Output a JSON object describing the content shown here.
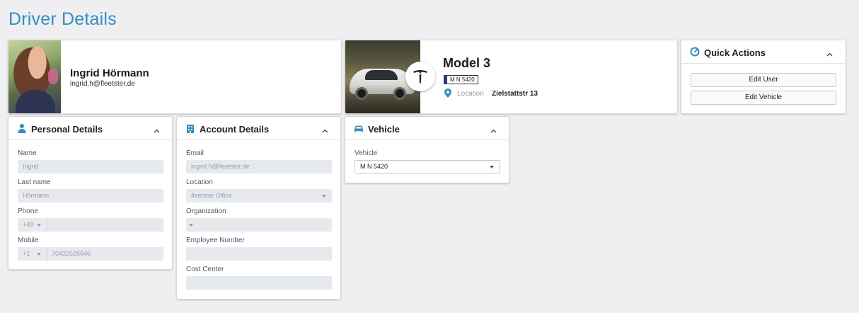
{
  "page": {
    "title": "Driver Details"
  },
  "driver": {
    "name": "Ingrid Hörmann",
    "email": "ingrid.h@fleetster.de"
  },
  "vehicle_summary": {
    "model": "Model 3",
    "plate": "M N 5420",
    "location_label": "Location",
    "location_value": "Zielstattstr 13"
  },
  "quick_actions": {
    "title": "Quick Actions",
    "buttons": [
      "Edit User",
      "Edit Vehicle"
    ]
  },
  "personal_details": {
    "title": "Personal Details",
    "fields": {
      "name": {
        "label": "Name",
        "value": "Ingrid"
      },
      "last_name": {
        "label": "Last name",
        "value": "Hörmann"
      },
      "phone": {
        "label": "Phone",
        "code": "+49",
        "value": ""
      },
      "mobile": {
        "label": "Mobile",
        "code": "+1",
        "value": "70432526646"
      }
    }
  },
  "account_details": {
    "title": "Account Details",
    "fields": {
      "email": {
        "label": "Email",
        "value": "ingrid.h@fleetster.de"
      },
      "location": {
        "label": "Location",
        "value": "fleetster Office"
      },
      "organization": {
        "label": "Organization",
        "value": ""
      },
      "employee_number": {
        "label": "Employee Number",
        "value": ""
      },
      "cost_center": {
        "label": "Cost Center",
        "value": ""
      }
    }
  },
  "vehicle_panel": {
    "title": "Vehicle",
    "field_label": "Vehicle",
    "selected": "M N 5420"
  },
  "colors": {
    "accent": "#2f8fc8",
    "input_bg": "#e6e9ee",
    "page_bg": "#efeef1"
  }
}
